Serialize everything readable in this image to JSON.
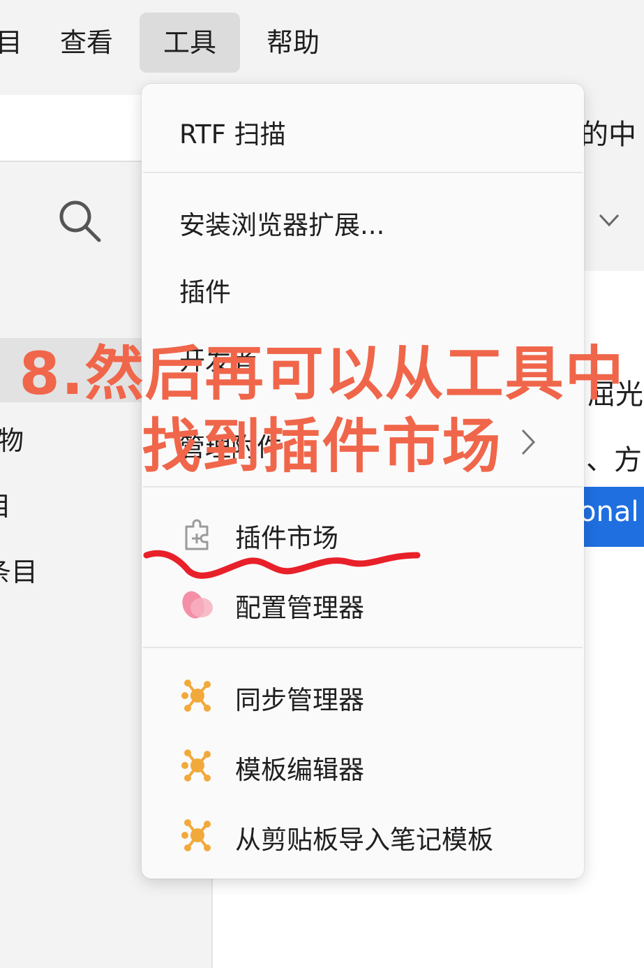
{
  "menubar": {
    "items": [
      {
        "label": "目"
      },
      {
        "label": "查看"
      },
      {
        "label": "工具"
      },
      {
        "label": "帮助"
      }
    ]
  },
  "left_pane": {
    "labels": [
      "物",
      "目",
      "条目"
    ]
  },
  "main_pane": {
    "snippets": [
      "的中",
      "屈光",
      "、方",
      "onal"
    ]
  },
  "dropdown": {
    "items": [
      {
        "label": "RTF 扫描",
        "icon": null
      },
      {
        "label": "安装浏览器扩展...",
        "icon": null
      },
      {
        "label": "插件",
        "icon": null
      },
      {
        "label": "开发者",
        "icon": null
      },
      {
        "label": "管理附件",
        "icon": null
      },
      {
        "label": "插件市场",
        "icon": "puzzle-plus-icon"
      },
      {
        "label": "配置管理器",
        "icon": "petal-icon"
      },
      {
        "label": "同步管理器",
        "icon": "molecule-icon"
      },
      {
        "label": "模板编辑器",
        "icon": "molecule-icon"
      },
      {
        "label": "从剪贴板导入笔记模板",
        "icon": "molecule-icon"
      }
    ]
  },
  "annotation": {
    "line1": "8.然后再可以从工具中",
    "line2": "找到插件市场",
    "color": "#f0664a",
    "underline_color": "#e8202a"
  },
  "colors": {
    "accent_blue": "#1f6fe0",
    "molecule_orange": "#f2a93b",
    "petal_pink": "#f48fa8"
  }
}
